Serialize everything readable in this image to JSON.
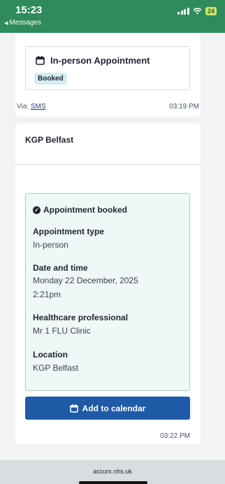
{
  "status_bar": {
    "time": "15:23",
    "back_label": "Messages",
    "battery": "24"
  },
  "message1": {
    "appointment_title": "In-person Appointment",
    "status_badge": "Booked",
    "via_label": "Via:",
    "via_channel": "SMS",
    "timestamp": "03:19 PM"
  },
  "message2": {
    "practice_name": "KGP Belfast",
    "confirmation": {
      "heading": "Appointment booked",
      "fields": [
        {
          "label": "Appointment type",
          "value": "In-person"
        },
        {
          "label": "Date and time",
          "value_lines": [
            "Monday 22 December, 2025",
            "2:21pm"
          ]
        },
        {
          "label": "Healthcare professional",
          "value": "Mr 1 FLU Clinic"
        },
        {
          "label": "Location",
          "value": "KGP Belfast"
        }
      ]
    },
    "calendar_button": "Add to calendar",
    "timestamp": "03:22 PM"
  },
  "browser": {
    "url": "accurx.nhs.uk"
  },
  "colors": {
    "status_bar_bg": "#2f8a5c",
    "primary_button": "#1f5aa6",
    "confirm_bg": "#eef8f7",
    "confirm_border": "#9bd4cc",
    "badge_bg": "#d5ecf0"
  }
}
